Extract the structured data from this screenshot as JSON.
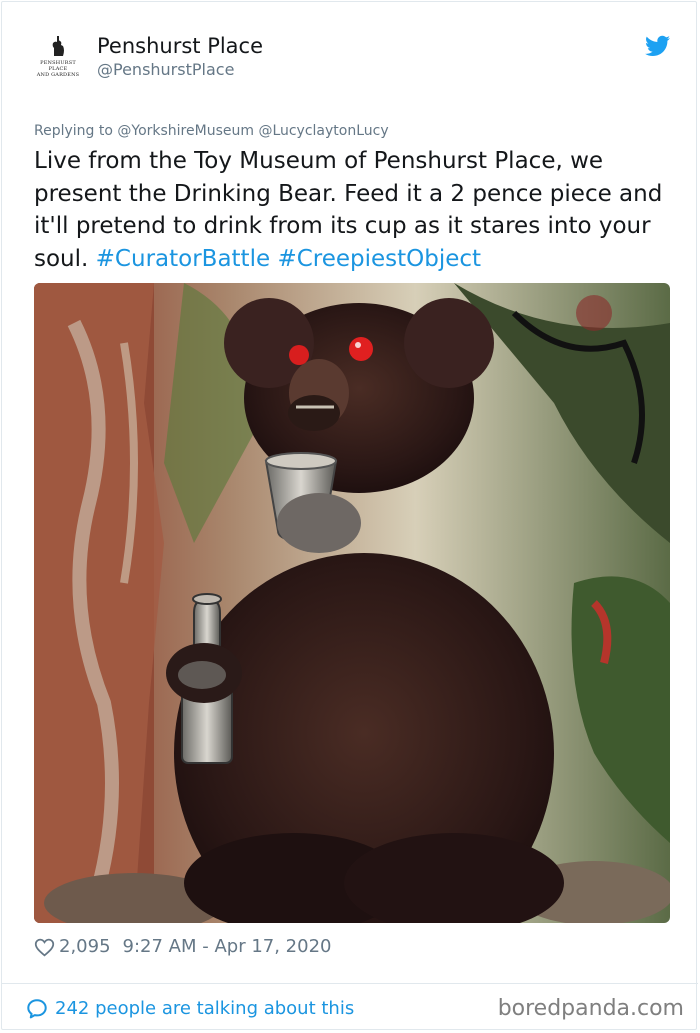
{
  "tweet": {
    "author_name": "Penshurst Place",
    "author_handle": "@PenshurstPlace",
    "avatar_text": [
      "PENSHURST",
      "PLACE",
      "AND GARDENS"
    ],
    "reply_to": "Replying to @YorkshireMuseum @LucyclaytonLucy",
    "text": "Live from the Toy Museum of Penshurst Place, we present the Drinking Bear. Feed it a 2 pence piece and it'll pretend to drink from its cup as it stares into your soul. ",
    "hashtags": [
      "#CuratorBattle",
      "#CreepiestObject"
    ],
    "likes": "2,095",
    "timestamp": "9:27 AM - Apr 17, 2020",
    "conversation": "242 people are talking about this"
  },
  "watermark": "boredpanda.com",
  "icons": {
    "platform": "twitter-bird-icon",
    "like": "heart-icon",
    "conversation": "speech-bubble-icon"
  },
  "colors": {
    "link": "#1b95e0",
    "secondary_text": "#657786",
    "border": "#e1e8ed",
    "twitter_blue": "#1da1f2"
  }
}
